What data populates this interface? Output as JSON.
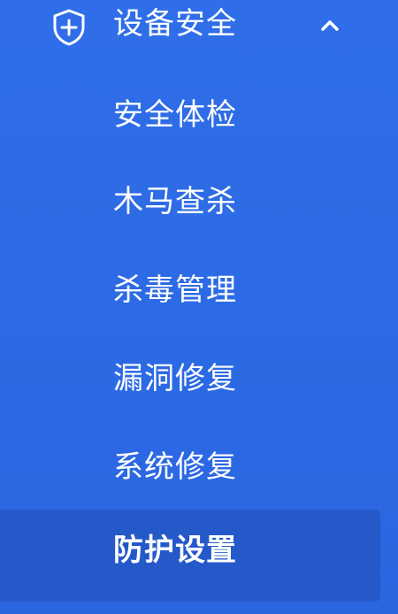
{
  "colors": {
    "background": "#2d6be6",
    "active_item_background": "#2559c9",
    "text": "#ffffff"
  },
  "sidebar": {
    "group": {
      "icon": "shield-plus-icon",
      "title": "设备安全",
      "expand_icon": "chevron-up-icon",
      "expanded": true
    },
    "items": [
      {
        "label": "安全体检",
        "active": false
      },
      {
        "label": "木马查杀",
        "active": false
      },
      {
        "label": "杀毒管理",
        "active": false
      },
      {
        "label": "漏洞修复",
        "active": false
      },
      {
        "label": "系统修复",
        "active": false
      },
      {
        "label": "防护设置",
        "active": true
      }
    ]
  }
}
